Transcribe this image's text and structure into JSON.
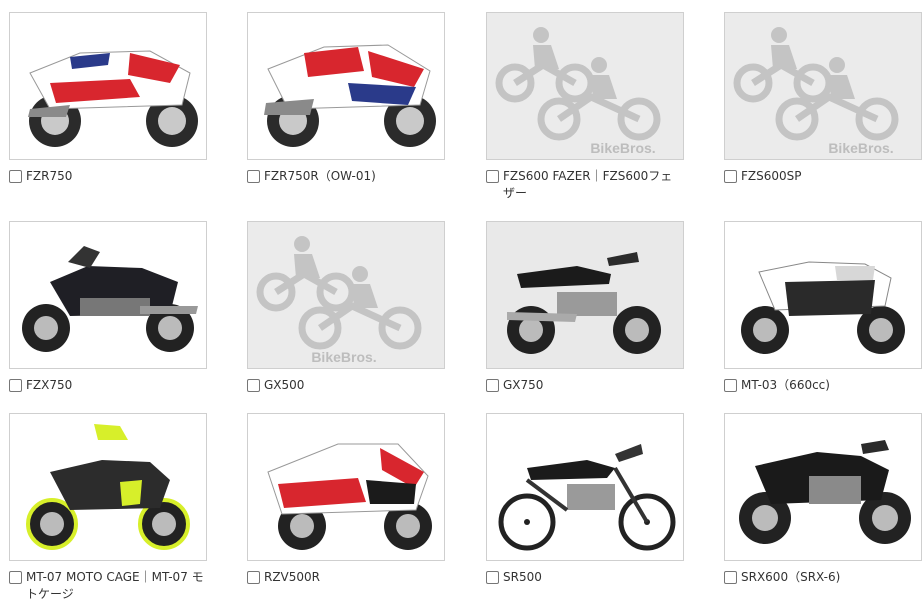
{
  "placeholder_text": "BikeBros.",
  "colors": {
    "placeholder_gray": "#c4c4c4",
    "border": "#cfcfcf"
  },
  "items": [
    {
      "label": "FZR750",
      "photo": "sportbike-red-white-blue-icon"
    },
    {
      "label": "FZR750R（OW-01)",
      "photo": "sportbike-red-white-blue-icon"
    },
    {
      "label": "FZS600 FAZER｜FZS600フェザー",
      "photo": "bikebros-placeholder-icon"
    },
    {
      "label": "FZS600SP",
      "photo": "bikebros-placeholder-icon"
    },
    {
      "label": "FZX750",
      "photo": "cruiser-black-icon"
    },
    {
      "label": "GX500",
      "photo": "bikebros-placeholder-icon"
    },
    {
      "label": "GX750",
      "photo": "classic-black-icon"
    },
    {
      "label": "MT-03（660cc)",
      "photo": "naked-white-black-icon"
    },
    {
      "label": "MT-07 MOTO CAGE｜MT-07 モトケージ",
      "photo": "naked-black-yellow-icon"
    },
    {
      "label": "RZV500R",
      "photo": "sportbike-red-white-icon"
    },
    {
      "label": "SR500",
      "photo": "classic-black-icon"
    },
    {
      "label": "SRX600（SRX-6)",
      "photo": "naked-black-icon"
    }
  ]
}
